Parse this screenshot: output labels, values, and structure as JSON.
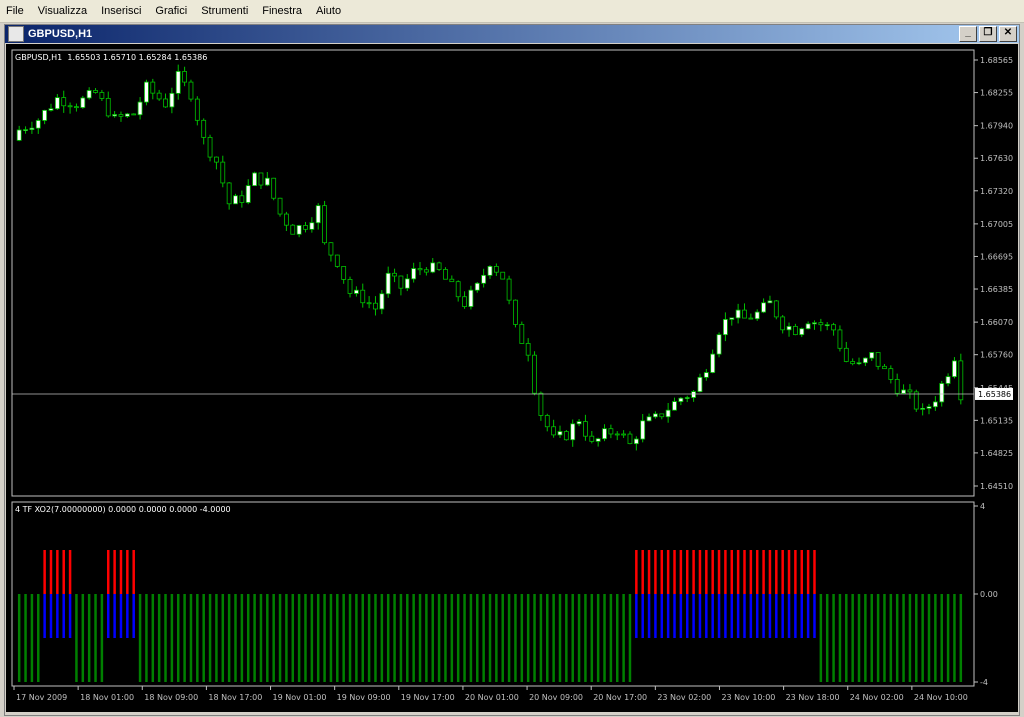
{
  "menu": [
    "File",
    "Visualizza",
    "Inserisci",
    "Grafici",
    "Strumenti",
    "Finestra",
    "Aiuto"
  ],
  "window": {
    "title": "GBPUSD,H1",
    "minimize": "_",
    "restore": "❐",
    "close": "✕"
  },
  "colors": {
    "bg": "#000000",
    "axis": "#c0c0c0",
    "bull": "#ffffff",
    "bear": "#000000",
    "wick": "#00c000",
    "red": "#ff0000",
    "blue": "#0000ff",
    "green": "#008000",
    "priceline": "#c0c0c0"
  },
  "chart_data": [
    {
      "type": "candlestick",
      "title": "GBPUSD,H1",
      "ohlc_header": "1.65503 1.65710 1.65284 1.65386",
      "current_price": "1.65386",
      "y_ticks": [
        "1.68565",
        "1.68255",
        "1.67940",
        "1.67630",
        "1.67320",
        "1.67005",
        "1.66695",
        "1.66385",
        "1.66070",
        "1.65760",
        "1.65445",
        "1.65135",
        "1.64825",
        "1.64510"
      ],
      "ylim": [
        1.6451,
        1.68565
      ],
      "x_ticks": [
        "17 Nov 2009",
        "18 Nov 01:00",
        "18 Nov 09:00",
        "18 Nov 17:00",
        "19 Nov 01:00",
        "19 Nov 09:00",
        "19 Nov 17:00",
        "20 Nov 01:00",
        "20 Nov 09:00",
        "20 Nov 17:00",
        "23 Nov 02:00",
        "23 Nov 10:00",
        "23 Nov 18:00",
        "24 Nov 02:00",
        "24 Nov 10:00"
      ],
      "close_path": [
        [
          0,
          1.679
        ],
        [
          3,
          1.68
        ],
        [
          6,
          1.682
        ],
        [
          9,
          1.6815
        ],
        [
          12,
          1.6825
        ],
        [
          15,
          1.68
        ],
        [
          18,
          1.6805
        ],
        [
          20,
          1.683
        ],
        [
          23,
          1.6815
        ],
        [
          25,
          1.684
        ],
        [
          27,
          1.6825
        ],
        [
          29,
          1.678
        ],
        [
          31,
          1.676
        ],
        [
          33,
          1.672
        ],
        [
          35,
          1.6725
        ],
        [
          37,
          1.6745
        ],
        [
          39,
          1.674
        ],
        [
          41,
          1.671
        ],
        [
          43,
          1.6695
        ],
        [
          45,
          1.67
        ],
        [
          47,
          1.6715
        ],
        [
          48,
          1.668
        ],
        [
          50,
          1.6665
        ],
        [
          52,
          1.6635
        ],
        [
          54,
          1.663
        ],
        [
          56,
          1.662
        ],
        [
          58,
          1.665
        ],
        [
          60,
          1.664
        ],
        [
          62,
          1.6655
        ],
        [
          64,
          1.666
        ],
        [
          66,
          1.6655
        ],
        [
          68,
          1.664
        ],
        [
          70,
          1.6625
        ],
        [
          72,
          1.664
        ],
        [
          74,
          1.6665
        ],
        [
          76,
          1.665
        ],
        [
          78,
          1.66
        ],
        [
          80,
          1.658
        ],
        [
          81,
          1.6545
        ],
        [
          82,
          1.652
        ],
        [
          84,
          1.6495
        ],
        [
          86,
          1.65
        ],
        [
          88,
          1.6515
        ],
        [
          90,
          1.649
        ],
        [
          92,
          1.65
        ],
        [
          94,
          1.6505
        ],
        [
          96,
          1.649
        ],
        [
          98,
          1.651
        ],
        [
          100,
          1.6515
        ],
        [
          102,
          1.6525
        ],
        [
          104,
          1.6535
        ],
        [
          106,
          1.654
        ],
        [
          108,
          1.6565
        ],
        [
          110,
          1.66
        ],
        [
          112,
          1.6615
        ],
        [
          114,
          1.661
        ],
        [
          116,
          1.6615
        ],
        [
          118,
          1.6625
        ],
        [
          120,
          1.6605
        ],
        [
          122,
          1.66
        ],
        [
          124,
          1.661
        ],
        [
          126,
          1.6605
        ],
        [
          128,
          1.66
        ],
        [
          130,
          1.657
        ],
        [
          132,
          1.6565
        ],
        [
          134,
          1.6575
        ],
        [
          136,
          1.656
        ],
        [
          138,
          1.6545
        ],
        [
          140,
          1.6535
        ],
        [
          142,
          1.652
        ],
        [
          144,
          1.6535
        ],
        [
          146,
          1.656
        ],
        [
          147,
          1.6575
        ],
        [
          148,
          1.6539
        ]
      ],
      "candle_count": 149
    },
    {
      "type": "bar",
      "title": "4 TF XO2(7.00000000) 0.0000 0.0000 0.0000 -4.0000",
      "y_ticks": [
        "4",
        "0.00",
        "-4"
      ],
      "ylim": [
        -4,
        4
      ],
      "bar_count": 149,
      "series": [
        {
          "color": "red",
          "values_desc": "+2 at bars 4-8, 14-18, 97-125",
          "runs": [
            [
              4,
              8,
              2
            ],
            [
              14,
              18,
              2
            ],
            [
              97,
              125,
              2
            ]
          ]
        },
        {
          "color": "blue",
          "values_desc": "-2 at same bars",
          "runs": [
            [
              4,
              8,
              -2
            ],
            [
              14,
              18,
              -2
            ],
            [
              97,
              125,
              -2
            ]
          ]
        },
        {
          "color": "green",
          "values_desc": "-4 elsewhere",
          "runs": [
            [
              0,
              3,
              -4
            ],
            [
              9,
              13,
              -4
            ],
            [
              19,
              96,
              -4
            ],
            [
              126,
              148,
              -4
            ]
          ]
        }
      ]
    }
  ]
}
